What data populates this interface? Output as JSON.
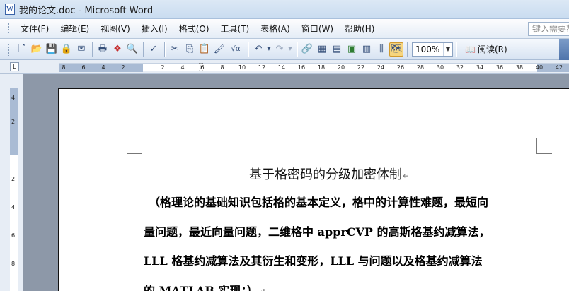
{
  "window": {
    "title": "我的论文.doc - Microsoft Word",
    "app_icon_letter": "W"
  },
  "menu": {
    "items": [
      "文件(F)",
      "编辑(E)",
      "视图(V)",
      "插入(I)",
      "格式(O)",
      "工具(T)",
      "表格(A)",
      "窗口(W)",
      "帮助(H)"
    ],
    "help_placeholder": "键入需要帮助的问题"
  },
  "toolbar": {
    "buttons": [
      {
        "name": "new-icon",
        "glyph": "🗋"
      },
      {
        "name": "open-icon",
        "glyph": "📂"
      },
      {
        "name": "save-icon",
        "glyph": "💾"
      },
      {
        "name": "permission-icon",
        "glyph": "🔒"
      },
      {
        "name": "email-icon",
        "glyph": "✉"
      },
      {
        "name": "print-icon",
        "glyph": "🖶"
      },
      {
        "name": "research-icon",
        "glyph": "❖"
      },
      {
        "name": "print-preview-icon",
        "glyph": "🔍"
      },
      {
        "name": "spelling-icon",
        "glyph": "✓"
      },
      {
        "name": "cut-icon",
        "glyph": "✂"
      },
      {
        "name": "copy-icon",
        "glyph": "⎘"
      },
      {
        "name": "paste-icon",
        "glyph": "📋"
      },
      {
        "name": "format-painter-icon",
        "glyph": "🖌"
      },
      {
        "name": "equation-icon",
        "glyph": "√α"
      },
      {
        "name": "undo-icon",
        "glyph": "↶"
      },
      {
        "name": "redo-icon",
        "glyph": "↷"
      },
      {
        "name": "hyperlink-icon",
        "glyph": "🔗"
      },
      {
        "name": "tables-borders-icon",
        "glyph": "▦"
      },
      {
        "name": "insert-table-icon",
        "glyph": "▤"
      },
      {
        "name": "insert-excel-icon",
        "glyph": "▣"
      },
      {
        "name": "columns-icon",
        "glyph": "▥"
      },
      {
        "name": "drawing-icon",
        "glyph": "⫼"
      },
      {
        "name": "document-map-icon",
        "glyph": "🗺"
      }
    ],
    "zoom_value": "100%",
    "read_label": "阅读(R)"
  },
  "ruler": {
    "horizontal_labels": [
      "8",
      "6",
      "4",
      "2",
      "2",
      "4",
      "6",
      "8",
      "10",
      "12",
      "14",
      "16",
      "18",
      "20",
      "22",
      "24",
      "26",
      "28",
      "30",
      "32",
      "34",
      "36",
      "38",
      "40",
      "42"
    ],
    "vertical_labels": [
      "4",
      "2",
      "2",
      "4",
      "6",
      "8"
    ],
    "tab_selector": "L"
  },
  "document": {
    "title": "基于格密码的分级加密体制",
    "paragraph_mark": "↵",
    "lines": [
      "（格理论的基础知识包括格的基本定义，格中的计算性难题，最短向",
      "量问题，最近向量问题，二维格中 apprCVP 的高斯格基约减算法，",
      "LLL 格基约减算法及其衍生和变形，LLL 与问题以及格基约减算法",
      "的 MATLAB 实现；）"
    ]
  }
}
